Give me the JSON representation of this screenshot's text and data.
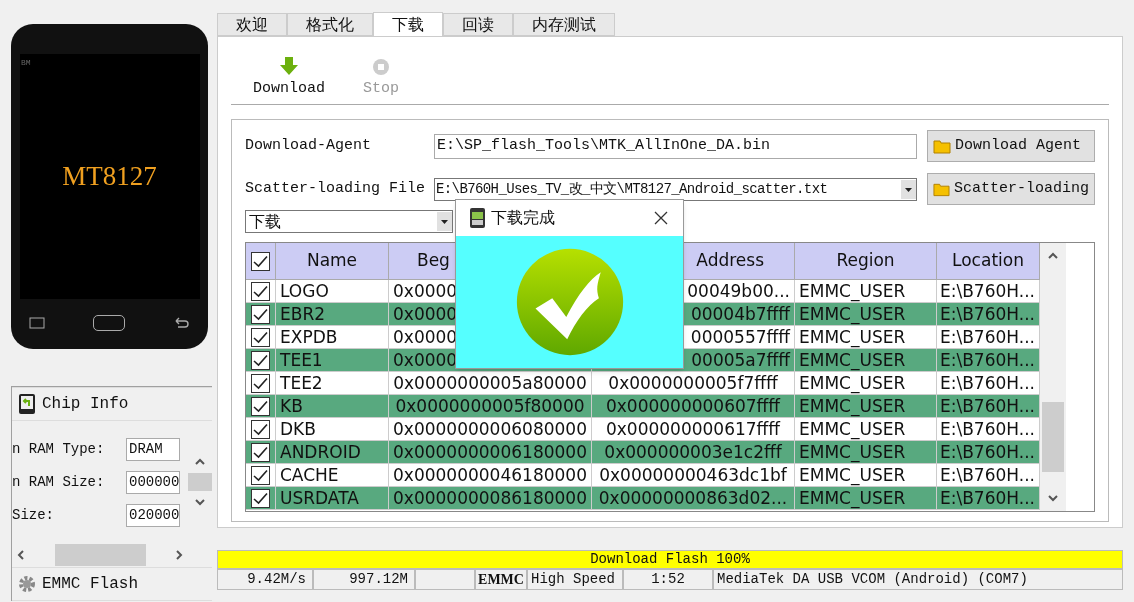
{
  "device": {
    "brand": "BM",
    "chip": "MT8127"
  },
  "left_panel": {
    "sections": [
      {
        "title": "Chip Info",
        "kind": "chip"
      },
      {
        "title": "EMMC Flash",
        "kind": "gear"
      }
    ],
    "chip_fields": [
      {
        "label": "n RAM Type:",
        "value": "DRAM"
      },
      {
        "label": "n RAM Size:",
        "value": "000000"
      },
      {
        "label": "Size:",
        "value": "020000"
      }
    ]
  },
  "tabs": [
    {
      "label": "欢迎",
      "selected": false
    },
    {
      "label": "格式化",
      "selected": false
    },
    {
      "label": "下载",
      "selected": true
    },
    {
      "label": "回读",
      "selected": false
    },
    {
      "label": "内存测试",
      "selected": false
    }
  ],
  "toolbar": [
    {
      "label": "Download",
      "kind": "download",
      "disabled": false
    },
    {
      "label": "Stop",
      "kind": "stop",
      "disabled": true
    }
  ],
  "download_agent": {
    "label": "Download-Agent",
    "value": "E:\\SP_flash_Tools\\MTK_AllInOne_DA.bin",
    "button": "Download Agent"
  },
  "scatter": {
    "label": "Scatter-loading File",
    "value": "E:\\B760H_Uses_TV_改_中文\\MT8127_Android_scatter.txt",
    "button": "Scatter-loading"
  },
  "mode_select": {
    "value": "下载"
  },
  "table": {
    "all_checked": true,
    "columns": [
      "Name",
      "Beg",
      "Address",
      "Region",
      "Location"
    ],
    "rows": [
      {
        "checked": true,
        "cells": [
          "LOGO",
          "0x0000",
          "00049b00...",
          "EMMC_USER",
          "E:\\B760H..."
        ]
      },
      {
        "checked": true,
        "cells": [
          "EBR2",
          "0x0000",
          "00004b7ffff",
          "EMMC_USER",
          "E:\\B760H..."
        ]
      },
      {
        "checked": true,
        "cells": [
          "EXPDB",
          "0x0000",
          "0000557ffff",
          "EMMC_USER",
          "E:\\B760H..."
        ]
      },
      {
        "checked": true,
        "cells": [
          "TEE1",
          "0x0000",
          "00005a7ffff",
          "EMMC_USER",
          "E:\\B760H..."
        ]
      },
      {
        "checked": true,
        "cells": [
          "TEE2",
          "0x0000000005a80000",
          "0x0000000005f7ffff",
          "EMMC_USER",
          "E:\\B760H..."
        ]
      },
      {
        "checked": true,
        "cells": [
          "KB",
          "0x0000000005f80000",
          "0x000000000607ffff",
          "EMMC_USER",
          "E:\\B760H..."
        ]
      },
      {
        "checked": true,
        "cells": [
          "DKB",
          "0x0000000006080000",
          "0x000000000617ffff",
          "EMMC_USER",
          "E:\\B760H..."
        ]
      },
      {
        "checked": true,
        "cells": [
          "ANDROID",
          "0x0000000006180000",
          "0x000000003e1c2fff",
          "EMMC_USER",
          "E:\\B760H..."
        ]
      },
      {
        "checked": true,
        "cells": [
          "CACHE",
          "0x0000000046180000",
          "0x00000000463dc1bf",
          "EMMC_USER",
          "E:\\B760H..."
        ]
      },
      {
        "checked": true,
        "cells": [
          "USRDATA",
          "0x0000000086180000",
          "0x00000000863d02...",
          "EMMC_USER",
          "E:\\B760H..."
        ]
      }
    ]
  },
  "dialog": {
    "title": "下载完成"
  },
  "progress": {
    "label": "Download Flash 100%",
    "level": 1
  },
  "status_bar": [
    {
      "text": "9.42M/s",
      "kind": "right"
    },
    {
      "text": "997.12M",
      "kind": "right"
    },
    {
      "kind": "blank"
    },
    {
      "text": "EMMC",
      "kind": "bold"
    },
    {
      "text": "High Speed",
      "kind": "left"
    },
    {
      "text": "1:52",
      "kind": "center"
    },
    {
      "text": "MediaTek DA USB VCOM (Android) (COM7)",
      "kind": "left"
    }
  ]
}
